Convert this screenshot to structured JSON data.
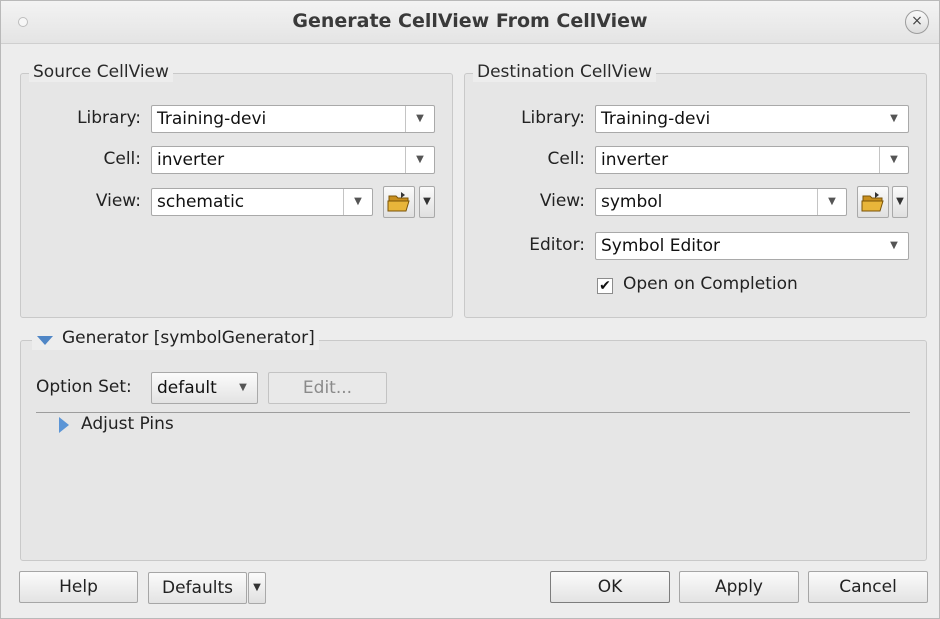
{
  "window": {
    "title": "Generate CellView From CellView",
    "close_glyph": "×"
  },
  "source": {
    "legend": "Source CellView",
    "library_label": "Library:",
    "library_value": "Training-devi",
    "cell_label": "Cell:",
    "cell_value": "inverter",
    "view_label": "View:",
    "view_value": "schematic"
  },
  "destination": {
    "legend": "Destination CellView",
    "library_label": "Library:",
    "library_value": "Training-devi",
    "cell_label": "Cell:",
    "cell_value": "inverter",
    "view_label": "View:",
    "view_value": "symbol",
    "editor_label": "Editor:",
    "editor_value": "Symbol Editor",
    "open_on_completion_label": "Open on Completion",
    "open_on_completion_checked": true,
    "check_glyph": "✔"
  },
  "generator": {
    "legend": "Generator [symbolGenerator]",
    "option_set_label": "Option Set:",
    "option_set_value": "default",
    "edit_label": "Edit...",
    "adjust_pins_label": "Adjust Pins"
  },
  "buttons": {
    "help": "Help",
    "defaults": "Defaults",
    "ok": "OK",
    "apply": "Apply",
    "cancel": "Cancel"
  },
  "glyphs": {
    "dropdown_arrow": "▼"
  },
  "colors": {
    "accent_triangle": "#4f86c6",
    "folder_yellow": "#e8b53a"
  }
}
